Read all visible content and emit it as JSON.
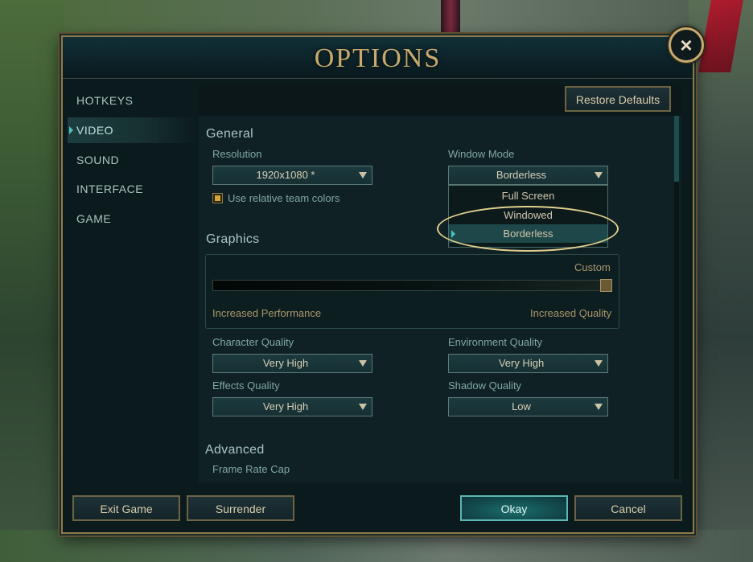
{
  "window": {
    "title": "OPTIONS",
    "close_icon": "×"
  },
  "sidebar": {
    "items": [
      {
        "label": "HOTKEYS",
        "active": false
      },
      {
        "label": "VIDEO",
        "active": true
      },
      {
        "label": "SOUND",
        "active": false
      },
      {
        "label": "INTERFACE",
        "active": false
      },
      {
        "label": "GAME",
        "active": false
      }
    ]
  },
  "toolbar": {
    "restore_defaults_label": "Restore Defaults"
  },
  "general": {
    "heading": "General",
    "resolution": {
      "label": "Resolution",
      "value": "1920x1080 *"
    },
    "window_mode": {
      "label": "Window Mode",
      "value": "Borderless",
      "options": [
        "Full Screen",
        "Windowed",
        "Borderless"
      ],
      "selected_index": 2
    },
    "relative_team_colors": {
      "label": "Use relative team colors",
      "checked": true
    }
  },
  "graphics": {
    "heading": "Graphics",
    "preset_label": "Custom",
    "slider_left_label": "Increased Performance",
    "slider_right_label": "Increased Quality",
    "slider_value": 1.0,
    "character_quality": {
      "label": "Character Quality",
      "value": "Very High"
    },
    "environment_quality": {
      "label": "Environment Quality",
      "value": "Very High"
    },
    "effects_quality": {
      "label": "Effects Quality",
      "value": "Very High"
    },
    "shadow_quality": {
      "label": "Shadow Quality",
      "value": "Low"
    }
  },
  "advanced": {
    "heading": "Advanced",
    "frame_rate_cap_label": "Frame Rate Cap"
  },
  "footer": {
    "exit_label": "Exit Game",
    "surrender_label": "Surrender",
    "okay_label": "Okay",
    "cancel_label": "Cancel"
  },
  "colors": {
    "gold": "#c8aa6e",
    "teal": "#4fc2c0",
    "panel": "#0f2124",
    "highlight": "#e2d18c"
  }
}
